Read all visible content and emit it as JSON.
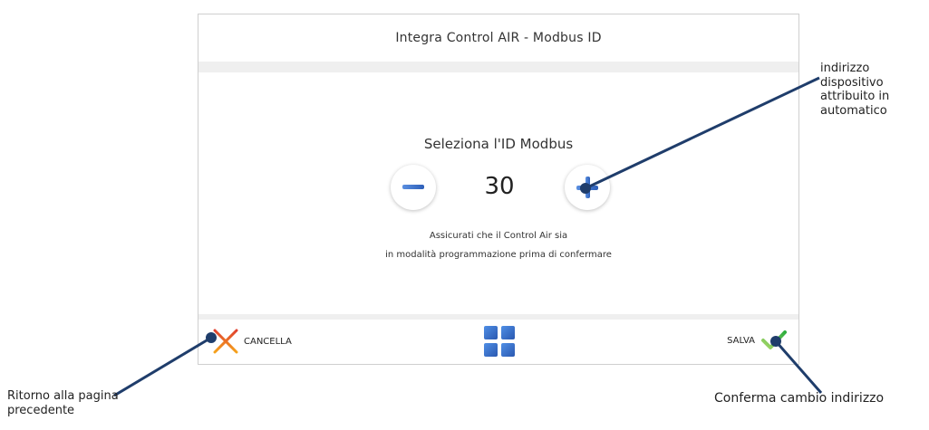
{
  "screen": {
    "title": "Integra Control AIR - Modbus ID",
    "select_label": "Seleziona l'ID Modbus",
    "modbus_id": "30",
    "hint_line1": "Assicurati che il Control Air sia",
    "hint_line2": "in modalità programmazione prima di confermare",
    "cancel_label": "CANCELLA",
    "save_label": "SALVA"
  },
  "callouts": {
    "device_address": [
      "indirizzo",
      "dispositivo",
      "attribuito in",
      "automatico"
    ],
    "back": [
      "Ritorno alla pagina",
      "precedente"
    ],
    "confirm": "Conferma cambio indirizzo"
  },
  "colors": {
    "accent_blue": "#2f6cc4",
    "callout_line": "#1f3d6b",
    "cancel_red": "#e0412f",
    "cancel_orange": "#f5a21b",
    "save_green": "#4cba4a"
  },
  "icons": [
    "minus-icon",
    "plus-icon",
    "cancel-x-icon",
    "home-grid-icon",
    "checkmark-icon"
  ]
}
